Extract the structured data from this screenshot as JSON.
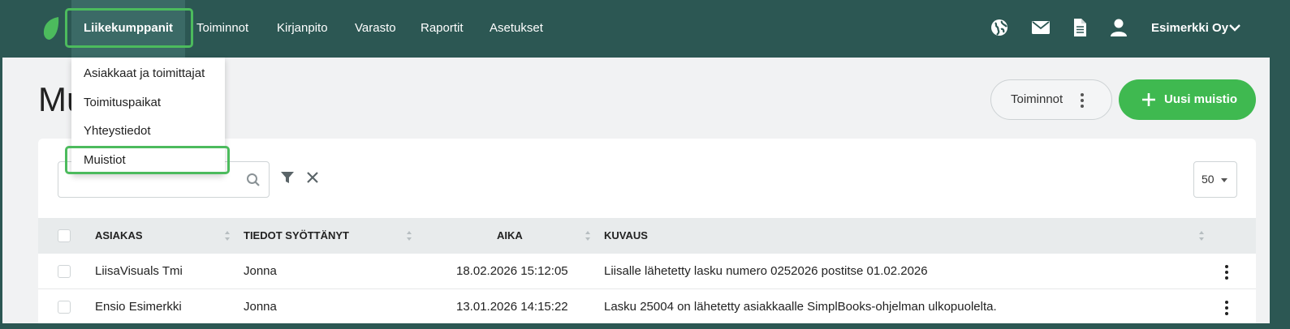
{
  "nav": {
    "items": [
      "Liikekumppanit",
      "Toiminnot",
      "Kirjanpito",
      "Varasto",
      "Raportit",
      "Asetukset"
    ],
    "company": "Esimerkki Oy"
  },
  "icons": [
    "globe-icon",
    "mail-icon",
    "document-icon",
    "user-icon",
    "chevron-down-icon"
  ],
  "dropdown": {
    "items": [
      "Asiakkaat ja toimittajat",
      "Toimituspaikat",
      "Yhteystiedot",
      "Muistiot"
    ]
  },
  "page": {
    "title_partial": "Mu",
    "actions_label": "Toiminnot",
    "new_label": "Uusi muistio"
  },
  "toolbar": {
    "search_placeholder": "",
    "page_size": "50"
  },
  "table": {
    "headers": [
      "ASIAKAS",
      "TIEDOT SYÖTTÄNYT",
      "AIKA",
      "KUVAUS"
    ],
    "rows": [
      {
        "asiakas": "LiisaVisuals Tmi",
        "syottanyt": "Jonna",
        "aika": "18.02.2026 15:12:05",
        "kuvaus": "Liisalle lähetetty lasku numero 0252026 postitse 01.02.2026"
      },
      {
        "asiakas": "Ensio Esimerkki",
        "syottanyt": "Jonna",
        "aika": "13.01.2026 14:15:22",
        "kuvaus": "Lasku 25004 on lähetetty asiakkaalle SimplBooks-ohjelman ulkopuolelta."
      }
    ]
  },
  "colors": {
    "topbar": "#2c5753",
    "accent": "#3fb950",
    "highlight": "#4cbb5d"
  }
}
